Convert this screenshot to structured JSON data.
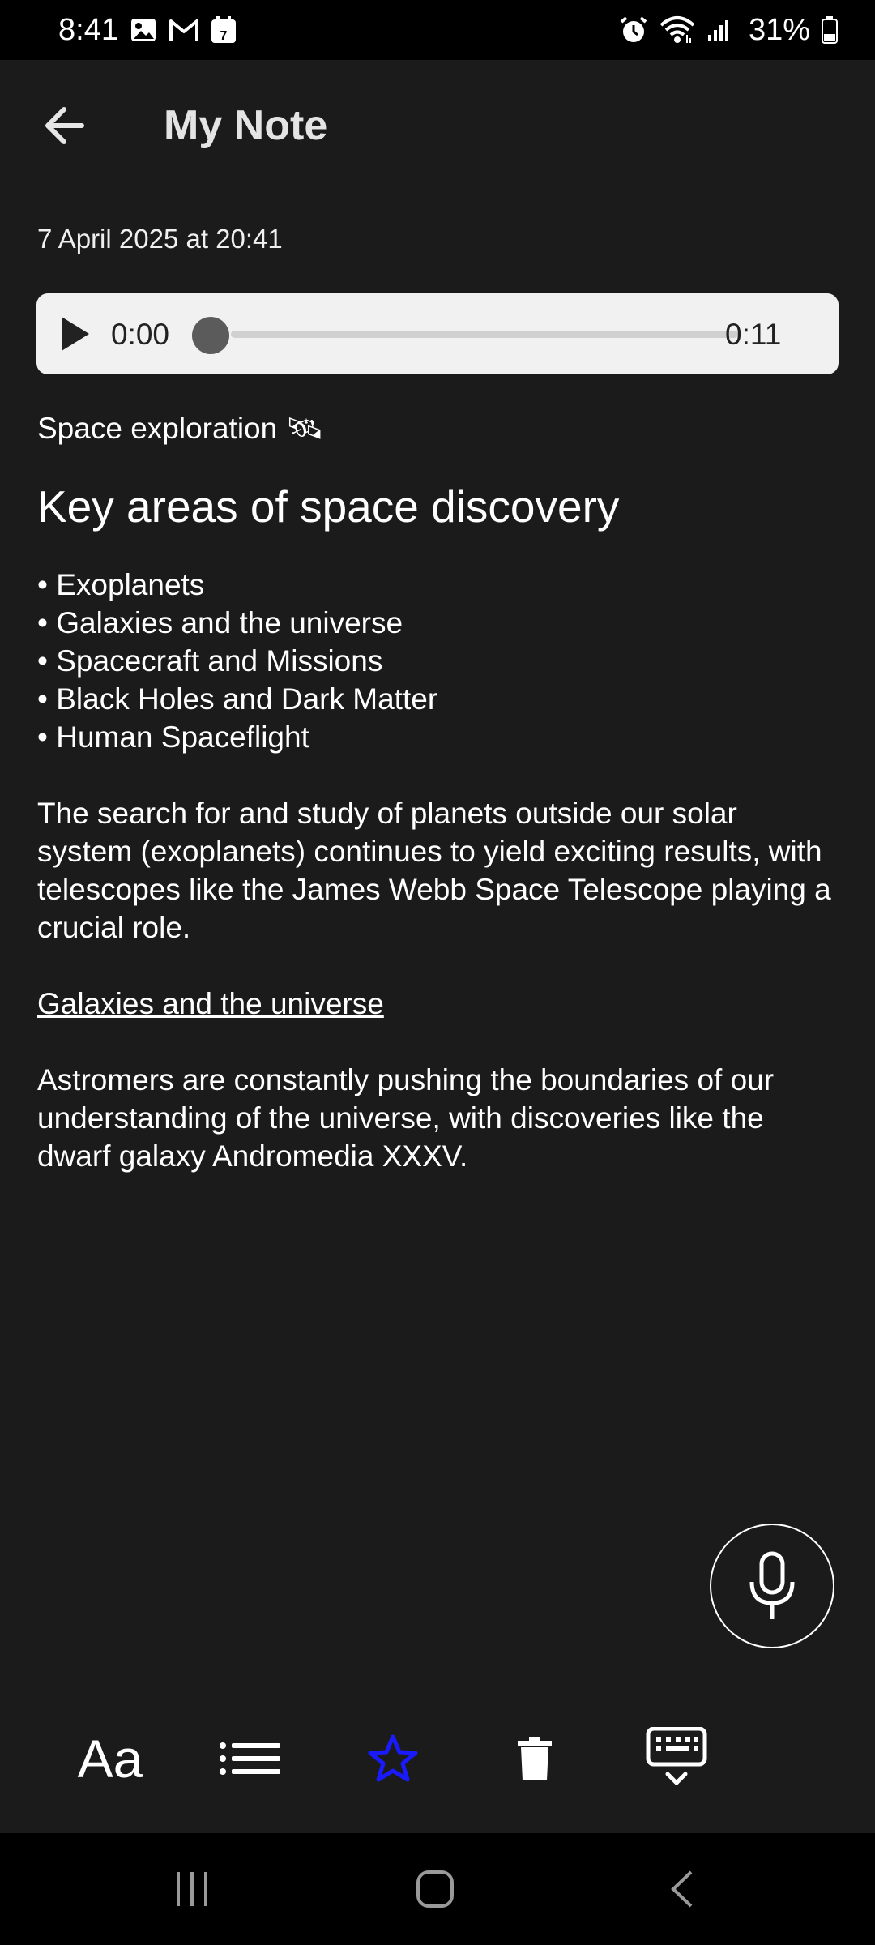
{
  "status_bar": {
    "time": "8:41",
    "left_icons": [
      "image-icon",
      "gmail-icon",
      "calendar-icon"
    ],
    "calendar_day": "7",
    "right_icons": [
      "alarm-icon",
      "wifi-icon",
      "signal-icon",
      "battery-icon"
    ],
    "battery": "31%"
  },
  "header": {
    "title": "My Note"
  },
  "note": {
    "date": "7 April 2025 at 20:41",
    "audio": {
      "current": "0:00",
      "total": "0:11",
      "progress": 0
    },
    "subtitle": "Space exploration 🛰",
    "heading": "Key areas of space discovery",
    "bullets": [
      "• Exoplanets",
      "• Galaxies and the universe",
      "• Spacecraft and Missions",
      "• Black Holes and Dark Matter",
      "• Human Spaceflight"
    ],
    "paragraph1": "The search for and study of planets outside our solar system (exoplanets) continues to yield exciting results, with telescopes like the James Webb Space Telescope playing a crucial role.",
    "link_text": "Galaxies and the universe",
    "paragraph2": "Astromers are constantly pushing the boundaries of our understanding of the universe, with discoveries like the dwarf galaxy Andromedia XXXV."
  },
  "toolbar": {
    "font_label": "Aa",
    "icons": [
      "text-format-icon",
      "list-icon",
      "star-icon",
      "trash-icon",
      "keyboard-hide-icon"
    ],
    "star_color": "#1a1aff"
  },
  "colors": {
    "background": "#1b1b1b",
    "player_background": "#f1f1f1",
    "bars": "#000000"
  }
}
